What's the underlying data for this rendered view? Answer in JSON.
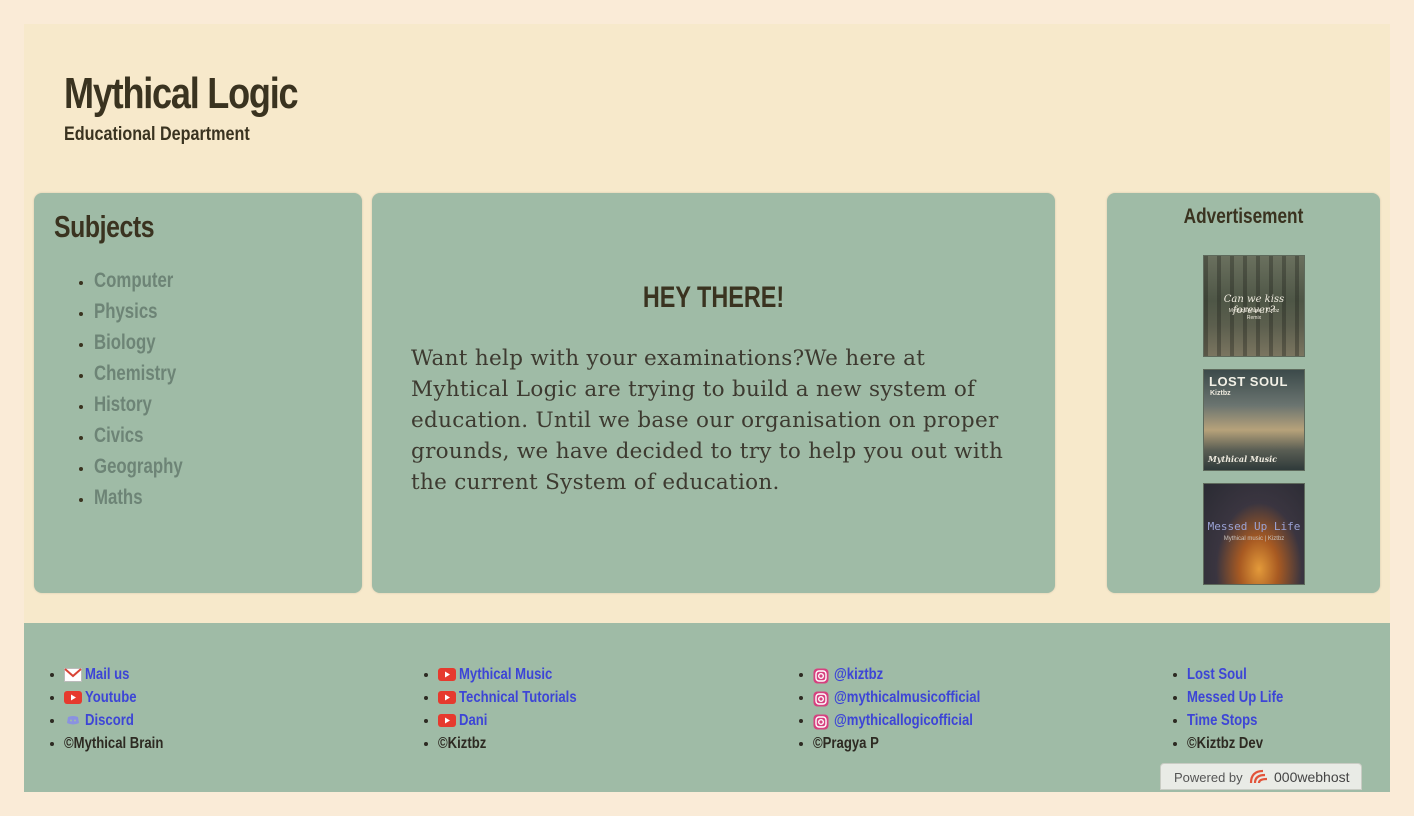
{
  "header": {
    "title": "Mythical Logic",
    "subtitle": "Educational Department"
  },
  "subjects": {
    "title": "Subjects",
    "items": [
      "Computer",
      "Physics",
      "Biology",
      "Chemistry",
      "History",
      "Civics",
      "Geography",
      "Maths"
    ]
  },
  "main": {
    "greeting": "HEY THERE!",
    "intro": "Want help with your examinations?We here at Myhtical Logic are trying to build a new system of education. Until we base our organisation on proper grounds, we have decided to try to help you out with the current System of education."
  },
  "ads": {
    "title": "Advertisement",
    "items": [
      {
        "main": "Can we kiss forever?",
        "sub": "Mythical Music | Kiztbz",
        "extra": "Remix"
      },
      {
        "main": "LOST SOUL",
        "sub": "Kiztbz",
        "extra": "Mythical Music"
      },
      {
        "main": "Messed Up Life",
        "sub": "Mythical music | Kiztbz"
      }
    ]
  },
  "footer": {
    "col1": {
      "links": [
        "Mail us",
        "Youtube",
        "Discord"
      ],
      "copyright": "©Mythical Brain"
    },
    "col2": {
      "links": [
        "Mythical Music",
        "Technical Tutorials",
        "Dani"
      ],
      "copyright": "©Kiztbz"
    },
    "col3": {
      "links": [
        "@kiztbz",
        "@mythicalmusicofficial",
        "@mythicallogicofficial"
      ],
      "copyright": "©Pragya P"
    },
    "col4": {
      "links": [
        "Lost Soul",
        "Messed Up Life",
        "Time Stops"
      ],
      "copyright": "©Kiztbz Dev"
    },
    "powered": {
      "label": "Powered by",
      "brand": "000webhost"
    }
  },
  "icons": {
    "mail": "mail-icon",
    "youtube": "youtube-icon",
    "discord": "discord-icon",
    "instagram": "instagram-icon"
  },
  "colors": {
    "page_bg": "#faebd7",
    "content_bg": "#f7e9cb",
    "panel_bg": "#9fbba6",
    "subject_link": "#6d8476",
    "footer_link": "#3d45d6",
    "heading_text": "#3a3320"
  }
}
